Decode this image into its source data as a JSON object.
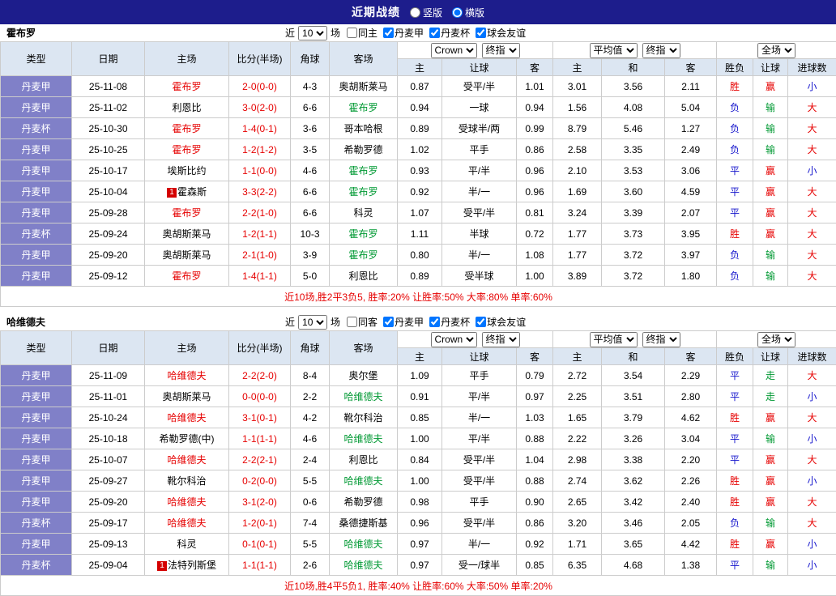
{
  "topbar": {
    "title": "近期战绩",
    "layout_options": [
      {
        "label": "竖版",
        "selected": false
      },
      {
        "label": "横版",
        "selected": true
      }
    ]
  },
  "colors": {
    "navy": "#1d1d8c",
    "header_bg": "#dce6f2",
    "type_bg": "#8080c8",
    "border": "#cccccc",
    "red": "#e60000",
    "green": "#009933",
    "blue": "#1414cc"
  },
  "result_classes": {
    "胜": "red",
    "平": "blue",
    "负": "blue",
    "赢": "red",
    "走": "green",
    "输": "green",
    "大": "red",
    "小": "blue"
  },
  "table": {
    "columns": [
      "类型",
      "日期",
      "主场",
      "比分(半场)",
      "角球",
      "客场"
    ],
    "sub_columns": [
      "主",
      "让球",
      "客",
      "主",
      "和",
      "客",
      "胜负",
      "让球",
      "进球数"
    ],
    "selects": {
      "asian": [
        "Crown",
        "终指"
      ],
      "euro": [
        "平均值",
        "终指"
      ],
      "scope": [
        "全场"
      ]
    }
  },
  "sections": [
    {
      "team": "霍布罗",
      "filter": {
        "near_label": "近",
        "games_value": "10",
        "games_label": "场",
        "checkboxes": [
          {
            "label": "同主",
            "checked": false
          },
          {
            "label": "丹麦甲",
            "checked": true
          },
          {
            "label": "丹麦杯",
            "checked": true
          },
          {
            "label": "球会友谊",
            "checked": true
          }
        ]
      },
      "rows": [
        {
          "league": "丹麦甲",
          "date": "25-11-08",
          "home": "霍布罗",
          "away": "奥胡斯莱马",
          "self": "home",
          "score": "2-0(0-0)",
          "corner": "4-3",
          "ah_home": "0.87",
          "ah_line": "受平/半",
          "ah_away": "1.01",
          "eu_home": "3.01",
          "eu_draw": "3.56",
          "eu_away": "2.11",
          "r_result": "胜",
          "r_handicap": "赢",
          "r_goals": "小"
        },
        {
          "league": "丹麦甲",
          "date": "25-11-02",
          "home": "利恩比",
          "away": "霍布罗",
          "self": "away",
          "score": "3-0(2-0)",
          "corner": "6-6",
          "ah_home": "0.94",
          "ah_line": "一球",
          "ah_away": "0.94",
          "eu_home": "1.56",
          "eu_draw": "4.08",
          "eu_away": "5.04",
          "r_result": "负",
          "r_handicap": "输",
          "r_goals": "大"
        },
        {
          "league": "丹麦杯",
          "date": "25-10-30",
          "home": "霍布罗",
          "away": "哥本哈根",
          "self": "home",
          "score": "1-4(0-1)",
          "corner": "3-6",
          "ah_home": "0.89",
          "ah_line": "受球半/两",
          "ah_away": "0.99",
          "eu_home": "8.79",
          "eu_draw": "5.46",
          "eu_away": "1.27",
          "r_result": "负",
          "r_handicap": "输",
          "r_goals": "大"
        },
        {
          "league": "丹麦甲",
          "date": "25-10-25",
          "home": "霍布罗",
          "away": "希勒罗德",
          "self": "home",
          "score": "1-2(1-2)",
          "corner": "3-5",
          "ah_home": "1.02",
          "ah_line": "平手",
          "ah_away": "0.86",
          "eu_home": "2.58",
          "eu_draw": "3.35",
          "eu_away": "2.49",
          "r_result": "负",
          "r_handicap": "输",
          "r_goals": "大"
        },
        {
          "league": "丹麦甲",
          "date": "25-10-17",
          "home": "埃斯比约",
          "away": "霍布罗",
          "self": "away",
          "score": "1-1(0-0)",
          "corner": "4-6",
          "ah_home": "0.93",
          "ah_line": "平/半",
          "ah_away": "0.96",
          "eu_home": "2.10",
          "eu_draw": "3.53",
          "eu_away": "3.06",
          "r_result": "平",
          "r_handicap": "赢",
          "r_goals": "小"
        },
        {
          "league": "丹麦甲",
          "date": "25-10-04",
          "home": "霍森斯",
          "home_badge": "1",
          "away": "霍布罗",
          "self": "away",
          "score": "3-3(2-2)",
          "corner": "6-6",
          "ah_home": "0.92",
          "ah_line": "半/一",
          "ah_away": "0.96",
          "eu_home": "1.69",
          "eu_draw": "3.60",
          "eu_away": "4.59",
          "r_result": "平",
          "r_handicap": "赢",
          "r_goals": "大"
        },
        {
          "league": "丹麦甲",
          "date": "25-09-28",
          "home": "霍布罗",
          "away": "科灵",
          "self": "home",
          "score": "2-2(1-0)",
          "corner": "6-6",
          "ah_home": "1.07",
          "ah_line": "受平/半",
          "ah_away": "0.81",
          "eu_home": "3.24",
          "eu_draw": "3.39",
          "eu_away": "2.07",
          "r_result": "平",
          "r_handicap": "赢",
          "r_goals": "大"
        },
        {
          "league": "丹麦杯",
          "date": "25-09-24",
          "home": "奥胡斯莱马",
          "away": "霍布罗",
          "self": "away",
          "score": "1-2(1-1)",
          "corner": "10-3",
          "ah_home": "1.11",
          "ah_line": "半球",
          "ah_away": "0.72",
          "eu_home": "1.77",
          "eu_draw": "3.73",
          "eu_away": "3.95",
          "r_result": "胜",
          "r_handicap": "赢",
          "r_goals": "大"
        },
        {
          "league": "丹麦甲",
          "date": "25-09-20",
          "home": "奥胡斯莱马",
          "away": "霍布罗",
          "self": "away",
          "score": "2-1(1-0)",
          "corner": "3-9",
          "ah_home": "0.80",
          "ah_line": "半/一",
          "ah_away": "1.08",
          "eu_home": "1.77",
          "eu_draw": "3.72",
          "eu_away": "3.97",
          "r_result": "负",
          "r_handicap": "输",
          "r_goals": "大"
        },
        {
          "league": "丹麦甲",
          "date": "25-09-12",
          "home": "霍布罗",
          "away": "利恩比",
          "self": "home",
          "score": "1-4(1-1)",
          "corner": "5-0",
          "ah_home": "0.89",
          "ah_line": "受半球",
          "ah_away": "1.00",
          "eu_home": "3.89",
          "eu_draw": "3.72",
          "eu_away": "1.80",
          "r_result": "负",
          "r_handicap": "输",
          "r_goals": "大"
        }
      ],
      "summary": "近10场,胜2平3负5, 胜率:20% 让胜率:50% 大率:80% 单率:60%"
    },
    {
      "team": "哈维德夫",
      "filter": {
        "near_label": "近",
        "games_value": "10",
        "games_label": "场",
        "checkboxes": [
          {
            "label": "同客",
            "checked": false
          },
          {
            "label": "丹麦甲",
            "checked": true
          },
          {
            "label": "丹麦杯",
            "checked": true
          },
          {
            "label": "球会友谊",
            "checked": true
          }
        ]
      },
      "rows": [
        {
          "league": "丹麦甲",
          "date": "25-11-09",
          "home": "哈维德夫",
          "away": "奥尔堡",
          "self": "home",
          "score": "2-2(2-0)",
          "corner": "8-4",
          "ah_home": "1.09",
          "ah_line": "平手",
          "ah_away": "0.79",
          "eu_home": "2.72",
          "eu_draw": "3.54",
          "eu_away": "2.29",
          "r_result": "平",
          "r_handicap": "走",
          "r_goals": "大"
        },
        {
          "league": "丹麦甲",
          "date": "25-11-01",
          "home": "奥胡斯莱马",
          "away": "哈维德夫",
          "self": "away",
          "score": "0-0(0-0)",
          "corner": "2-2",
          "ah_home": "0.91",
          "ah_line": "平/半",
          "ah_away": "0.97",
          "eu_home": "2.25",
          "eu_draw": "3.51",
          "eu_away": "2.80",
          "r_result": "平",
          "r_handicap": "走",
          "r_goals": "小"
        },
        {
          "league": "丹麦甲",
          "date": "25-10-24",
          "home": "哈维德夫",
          "away": "靴尔科治",
          "self": "home",
          "score": "3-1(0-1)",
          "corner": "4-2",
          "ah_home": "0.85",
          "ah_line": "半/一",
          "ah_away": "1.03",
          "eu_home": "1.65",
          "eu_draw": "3.79",
          "eu_away": "4.62",
          "r_result": "胜",
          "r_handicap": "赢",
          "r_goals": "大"
        },
        {
          "league": "丹麦甲",
          "date": "25-10-18",
          "home": "希勒罗德(中)",
          "away": "哈维德夫",
          "self": "away",
          "score": "1-1(1-1)",
          "corner": "4-6",
          "ah_home": "1.00",
          "ah_line": "平/半",
          "ah_away": "0.88",
          "eu_home": "2.22",
          "eu_draw": "3.26",
          "eu_away": "3.04",
          "r_result": "平",
          "r_handicap": "输",
          "r_goals": "小"
        },
        {
          "league": "丹麦甲",
          "date": "25-10-07",
          "home": "哈维德夫",
          "away": "利恩比",
          "self": "home",
          "score": "2-2(2-1)",
          "corner": "2-4",
          "ah_home": "0.84",
          "ah_line": "受平/半",
          "ah_away": "1.04",
          "eu_home": "2.98",
          "eu_draw": "3.38",
          "eu_away": "2.20",
          "r_result": "平",
          "r_handicap": "赢",
          "r_goals": "大"
        },
        {
          "league": "丹麦甲",
          "date": "25-09-27",
          "home": "靴尔科治",
          "away": "哈维德夫",
          "self": "away",
          "score": "0-2(0-0)",
          "corner": "5-5",
          "ah_home": "1.00",
          "ah_line": "受平/半",
          "ah_away": "0.88",
          "eu_home": "2.74",
          "eu_draw": "3.62",
          "eu_away": "2.26",
          "r_result": "胜",
          "r_handicap": "赢",
          "r_goals": "小"
        },
        {
          "league": "丹麦甲",
          "date": "25-09-20",
          "home": "哈维德夫",
          "away": "希勒罗德",
          "self": "home",
          "score": "3-1(2-0)",
          "corner": "0-6",
          "ah_home": "0.98",
          "ah_line": "平手",
          "ah_away": "0.90",
          "eu_home": "2.65",
          "eu_draw": "3.42",
          "eu_away": "2.40",
          "r_result": "胜",
          "r_handicap": "赢",
          "r_goals": "大"
        },
        {
          "league": "丹麦杯",
          "date": "25-09-17",
          "home": "哈维德夫",
          "away": "桑德捷斯基",
          "self": "home",
          "score": "1-2(0-1)",
          "corner": "7-4",
          "ah_home": "0.96",
          "ah_line": "受平/半",
          "ah_away": "0.86",
          "eu_home": "3.20",
          "eu_draw": "3.46",
          "eu_away": "2.05",
          "r_result": "负",
          "r_handicap": "输",
          "r_goals": "大"
        },
        {
          "league": "丹麦甲",
          "date": "25-09-13",
          "home": "科灵",
          "away": "哈维德夫",
          "self": "away",
          "score": "0-1(0-1)",
          "corner": "5-5",
          "ah_home": "0.97",
          "ah_line": "半/一",
          "ah_away": "0.92",
          "eu_home": "1.71",
          "eu_draw": "3.65",
          "eu_away": "4.42",
          "r_result": "胜",
          "r_handicap": "赢",
          "r_goals": "小"
        },
        {
          "league": "丹麦杯",
          "date": "25-09-04",
          "home": "法特列斯堡",
          "home_badge": "1",
          "away": "哈维德夫",
          "self": "away",
          "score": "1-1(1-1)",
          "corner": "2-6",
          "ah_home": "0.97",
          "ah_line": "受一/球半",
          "ah_away": "0.85",
          "eu_home": "6.35",
          "eu_draw": "4.68",
          "eu_away": "1.38",
          "r_result": "平",
          "r_handicap": "输",
          "r_goals": "小"
        }
      ],
      "summary": "近10场,胜4平5负1, 胜率:40% 让胜率:60% 大率:50% 单率:20%"
    }
  ]
}
